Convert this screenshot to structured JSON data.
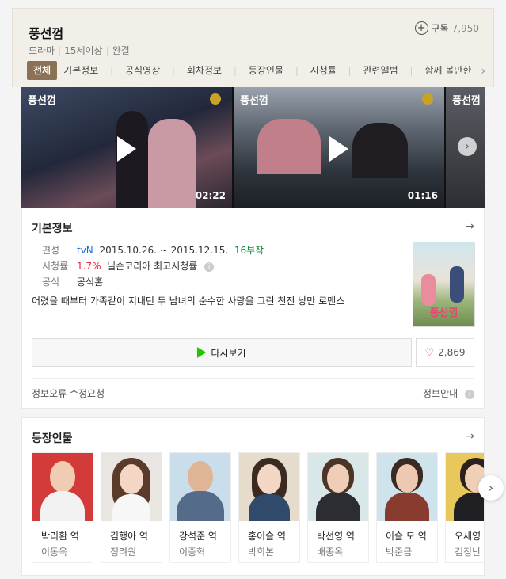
{
  "header": {
    "title": "풍선껌",
    "meta": [
      "드라마",
      "15세이상",
      "완결"
    ],
    "subscribe_label": "구독",
    "subscribe_count": "7,950"
  },
  "tabs": [
    "전체",
    "기본정보",
    "공식영상",
    "회차정보",
    "등장인물",
    "시청률",
    "관련앨범",
    "함께 볼만한"
  ],
  "videos": [
    {
      "logo": "풍선껌",
      "duration": "02:22"
    },
    {
      "logo": "풍선껌",
      "duration": "01:16"
    },
    {
      "logo": "풍선껌",
      "duration": ""
    }
  ],
  "info": {
    "title": "기본정보",
    "broadcast_label": "편성",
    "channel": "tvN",
    "period": "2015.10.26. ~ 2015.12.15.",
    "episodes": "16부작",
    "rating_label": "시청률",
    "rating_value": "1.7%",
    "rating_source": "닐슨코리아 최고시청률",
    "official_label": "공식",
    "official_link": "공식홈",
    "description": "어렸을 때부터 가족같이 지내던 두 남녀의 순수한 사랑을 그린 천진 낭만 로맨스",
    "poster_text": "풍선껌",
    "watch_label": "다시보기",
    "like_count": "2,869",
    "error_label": "정보오류 수정요청",
    "guide_label": "정보안내"
  },
  "cast": {
    "title": "등장인물",
    "items": [
      {
        "role": "박리환 역",
        "actor": "이동욱",
        "bg": "#d33a3a"
      },
      {
        "role": "김행아 역",
        "actor": "정려원",
        "bg": "#e9e6e2"
      },
      {
        "role": "강석준 역",
        "actor": "이종혁",
        "bg": "#c9ddea"
      },
      {
        "role": "홍이슬 역",
        "actor": "박희본",
        "bg": "#e6dccb"
      },
      {
        "role": "박선영 역",
        "actor": "배종옥",
        "bg": "#d9e7e8"
      },
      {
        "role": "이슬 모 역",
        "actor": "박준금",
        "bg": "#cfe3ec"
      },
      {
        "role": "오세영 역",
        "actor": "김정난",
        "bg": "#e8c85a"
      }
    ]
  }
}
